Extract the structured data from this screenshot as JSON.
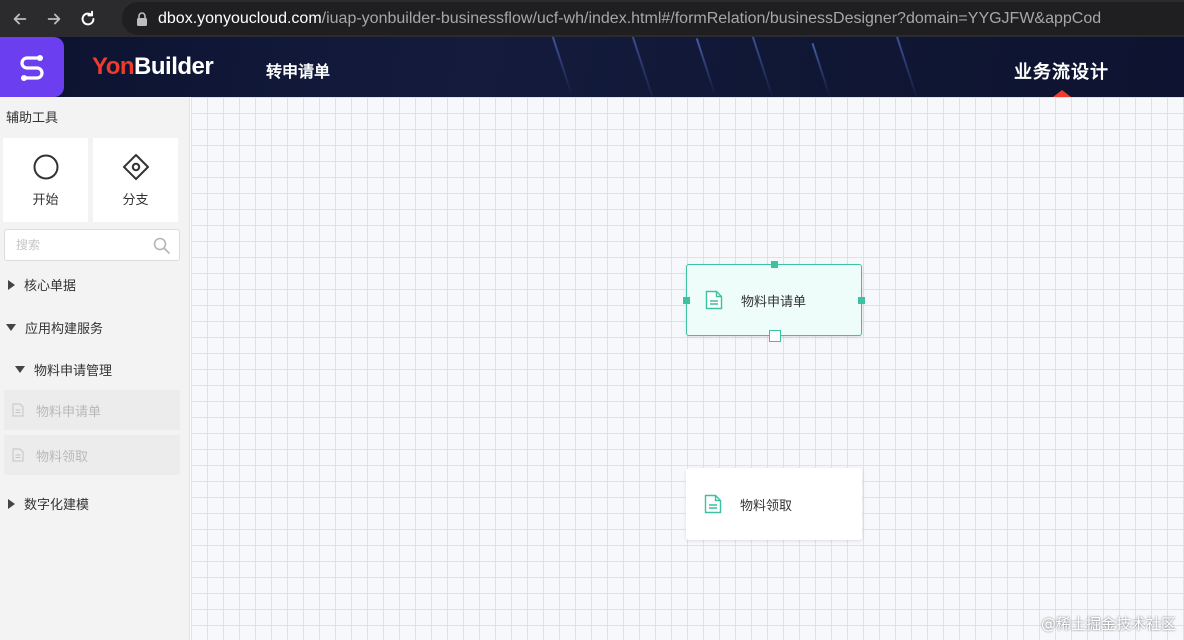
{
  "browser": {
    "url_host": "dbox.yonyoucloud.com",
    "url_path": "/iuap-yonbuilder-businessflow/ucf-wh/index.html#/formRelation/businessDesigner?domain=YYGJFW&appCod"
  },
  "header": {
    "brand_yon": "Yon",
    "brand_builder": "Builder",
    "page_title": "转申请单",
    "active_tab": "业务流设计",
    "accent_color": "#ef3b2d",
    "logo_color": "#6b3ff0"
  },
  "sidebar": {
    "title": "辅助工具",
    "tools": [
      {
        "label": "开始",
        "icon": "circle-icon"
      },
      {
        "label": "分支",
        "icon": "diamond-icon"
      }
    ],
    "search": {
      "placeholder": "搜索",
      "value": ""
    },
    "tree": {
      "core_docs": {
        "label": "核心单据",
        "expanded": false
      },
      "app_services": {
        "label": "应用构建服务",
        "expanded": true
      },
      "material_mgmt": {
        "label": "物料申请管理",
        "expanded": true
      },
      "leaves": [
        "物料申请单",
        "物料领取"
      ],
      "digital_modeling": {
        "label": "数字化建模",
        "expanded": false
      }
    }
  },
  "canvas": {
    "nodes": [
      {
        "label": "物料申请单",
        "selected": true
      },
      {
        "label": "物料领取",
        "selected": false
      }
    ],
    "accent_color": "#3cc1a1"
  },
  "watermark": "@稀土掘金技术社区"
}
